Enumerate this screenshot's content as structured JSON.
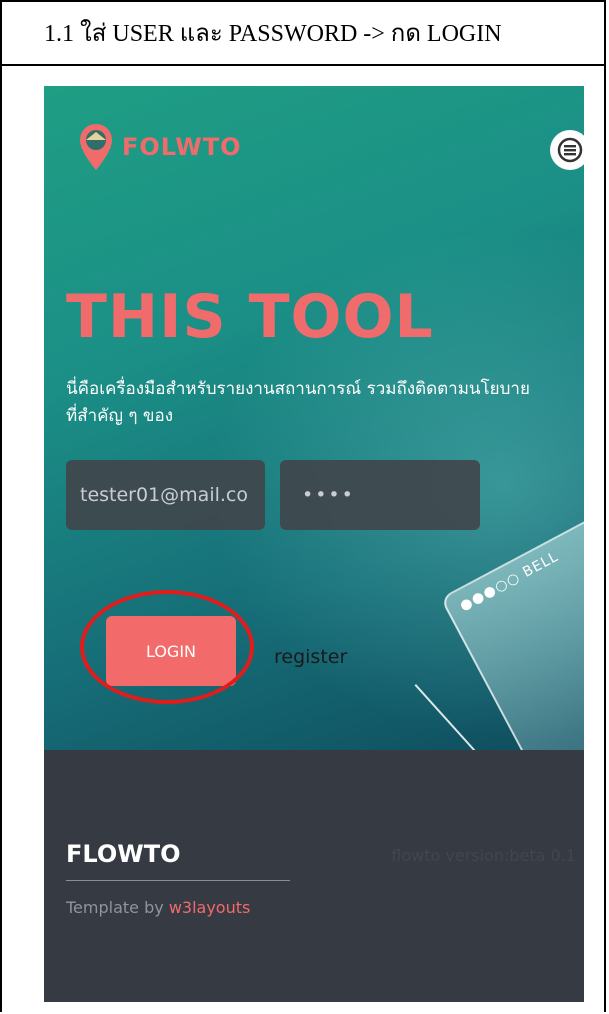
{
  "caption": "1.1 ใส่ USER และ PASSWORD -> กด LOGIN",
  "app": {
    "logo_text": "FOLWTO",
    "menu_icon": "hamburger-menu-icon"
  },
  "hero": {
    "title": "THIS TOOL",
    "description": "นี่คือเครื่องมือสำหรับรายงานสถานการณ์ รวมถึงติดตามนโยบายที่สำคัญ ๆ ของ"
  },
  "login_form": {
    "email_value": "tester01@mail.co",
    "password_value": "••••",
    "login_label": "LOGIN",
    "register_label": "register"
  },
  "decoration": {
    "phone_text": "●●●○○ BELL"
  },
  "footer": {
    "brand": "FLOWTO",
    "version": "flowto version:beta 0.1",
    "credit_prefix": "Template by ",
    "credit_link": "w3layouts"
  },
  "colors": {
    "accent": "#f06b6b",
    "login_button": "#f36a6a",
    "highlight_circle": "#e21b1b",
    "footer_bg": "#363a43",
    "hero_gradient_start": "#1f9e84",
    "hero_gradient_end": "#0f4d5e"
  }
}
